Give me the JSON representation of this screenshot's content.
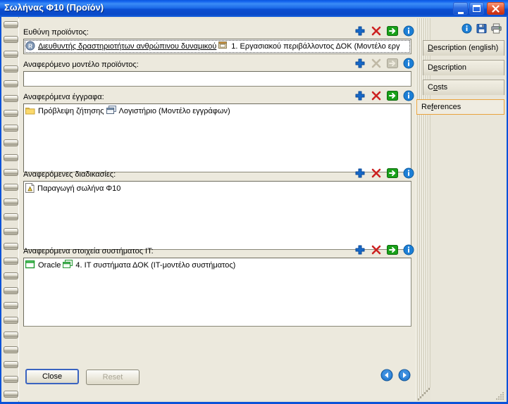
{
  "window": {
    "title": "Σωλήνας Φ10 (Προϊόν)",
    "minimize_label": "_",
    "maximize_label": "□",
    "close_label": "✕",
    "accent_titlebar": "#1464ee",
    "client_bg": "#e7e4d7",
    "active_tab_border": "#e8a33d"
  },
  "top_icons": [
    {
      "name": "info-icon",
      "title": "Info"
    },
    {
      "name": "save-icon",
      "title": "Save"
    },
    {
      "name": "print-icon",
      "title": "Print"
    }
  ],
  "sections": [
    {
      "id": "product-responsibility",
      "label": "Ευθύνη προϊόντος:",
      "tools": [
        "add-icon",
        "delete-icon",
        "goto-icon",
        "info-icon"
      ],
      "rows": [
        {
          "focused": true,
          "chips": [
            {
              "icon": "role-icon",
              "text": "Διευθυντής δραστηριοτήτων ανθρώπινου δυναμικού",
              "underline": true
            },
            {
              "icon": "model-icon",
              "text": "1. Εργασιακού περιβάλλοντος ΔΟΚ (Μοντέλο εργ"
            }
          ]
        }
      ]
    },
    {
      "id": "referenced-product-model",
      "label": "Αναφερόμενο μοντέλο προϊόντος:",
      "tools": [
        "add-icon",
        "delete-icon",
        "goto-icon",
        "info-icon"
      ],
      "rows": []
    },
    {
      "id": "referenced-documents",
      "label": "Αναφερόμενα έγγραφα:",
      "tools": [
        "add-icon",
        "delete-icon",
        "goto-icon",
        "info-icon"
      ],
      "rows": [
        {
          "focused": false,
          "chips": [
            {
              "icon": "folder-icon",
              "text": "Πρόβλεψη ζήτησης"
            },
            {
              "icon": "doc-model-icon",
              "text": "Λογιστήριο (Μοντέλο εγγράφων)"
            }
          ]
        }
      ]
    },
    {
      "id": "referenced-processes",
      "label": "Αναφερόμενες διαδικασίες:",
      "tools": [
        "add-icon",
        "delete-icon",
        "goto-icon",
        "info-icon"
      ],
      "rows": [
        {
          "focused": false,
          "chips": [
            {
              "icon": "process-icon",
              "text": "Παραγωγή σωλήνα Φ10"
            }
          ]
        }
      ]
    },
    {
      "id": "referenced-it-elements",
      "label": "Αναφερόμενα στοιχεία συστήματος IT:",
      "tools": [
        "add-icon",
        "delete-icon",
        "goto-icon",
        "info-icon"
      ],
      "rows": [
        {
          "focused": false,
          "chips": [
            {
              "icon": "it-system-icon",
              "text": "Oracle"
            },
            {
              "icon": "it-model-icon",
              "text": "4. IT συστήματα ΔΟΚ (IT-μοντέλο συστήματος)"
            }
          ]
        }
      ]
    }
  ],
  "tabs": [
    {
      "id": "description-english",
      "pre": "D",
      "post": "escription (english)",
      "active": false
    },
    {
      "id": "description",
      "pre": "D",
      "mid": "e",
      "post": "scription",
      "active": false
    },
    {
      "id": "costs",
      "pre": "C",
      "mid": "o",
      "post": "sts",
      "active": false
    },
    {
      "id": "references",
      "pre": "Re",
      "mid": "f",
      "post": "erences",
      "active": true
    }
  ],
  "footer": {
    "close_label": "Close",
    "reset_label": "Reset",
    "prev_label": "◀",
    "next_label": "▶"
  }
}
